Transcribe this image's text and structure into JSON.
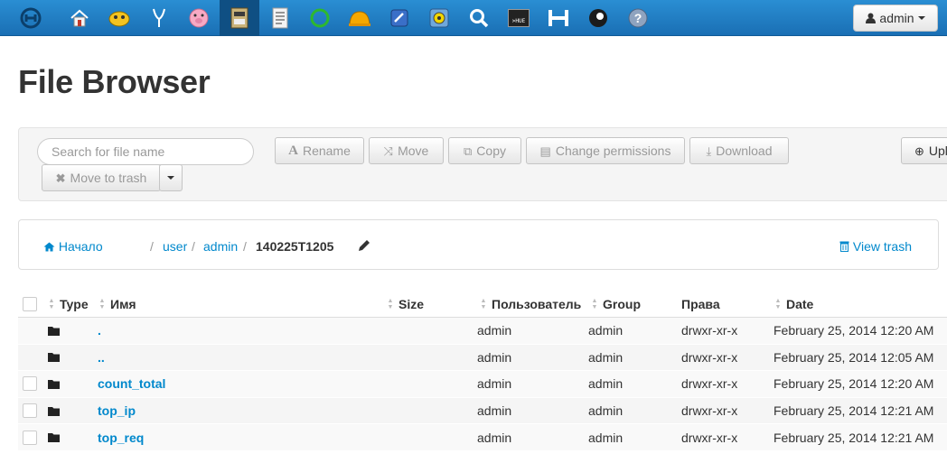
{
  "nav": {
    "apps": [
      {
        "icon": "hue-logo-icon"
      },
      {
        "icon": "home-icon"
      },
      {
        "icon": "hive-icon"
      },
      {
        "icon": "impala-icon"
      },
      {
        "icon": "pig-icon"
      },
      {
        "icon": "file-browser-icon",
        "active": true
      },
      {
        "icon": "job-browser-icon"
      },
      {
        "icon": "oozie-icon"
      },
      {
        "icon": "hbase-icon"
      },
      {
        "icon": "sqoop-icon"
      },
      {
        "icon": "zookeeper-icon"
      },
      {
        "icon": "search-icon"
      },
      {
        "icon": "shell-icon",
        "label": ">HUE"
      },
      {
        "icon": "hdfs-icon"
      },
      {
        "icon": "profile-icon"
      },
      {
        "icon": "help-icon"
      }
    ],
    "user_label": "admin"
  },
  "page": {
    "title": "File Browser"
  },
  "toolbar": {
    "search_placeholder": "Search for file name",
    "rename": "Rename",
    "move": "Move",
    "copy": "Copy",
    "change_permissions": "Change permissions",
    "download": "Download",
    "upload": "Upload",
    "move_to_trash": "Move to trash"
  },
  "breadcrumb": {
    "home": "Начало",
    "separator": "/",
    "parts": [
      "user",
      "admin"
    ],
    "current": "140225T1205",
    "view_trash": "View trash"
  },
  "table": {
    "headers": {
      "type": "Type",
      "name": "Имя",
      "size": "Size",
      "user": "Пользователь",
      "group": "Group",
      "perms": "Права",
      "date": "Date"
    },
    "rows": [
      {
        "name": ".",
        "size": "",
        "user": "admin",
        "group": "admin",
        "perms": "drwxr-xr-x",
        "date": "February 25, 2014 12:20 AM",
        "selectable": false
      },
      {
        "name": "..",
        "size": "",
        "user": "admin",
        "group": "admin",
        "perms": "drwxr-xr-x",
        "date": "February 25, 2014 12:05 AM",
        "selectable": false
      },
      {
        "name": "count_total",
        "size": "",
        "user": "admin",
        "group": "admin",
        "perms": "drwxr-xr-x",
        "date": "February 25, 2014 12:20 AM",
        "selectable": true
      },
      {
        "name": "top_ip",
        "size": "",
        "user": "admin",
        "group": "admin",
        "perms": "drwxr-xr-x",
        "date": "February 25, 2014 12:21 AM",
        "selectable": true
      },
      {
        "name": "top_req",
        "size": "",
        "user": "admin",
        "group": "admin",
        "perms": "drwxr-xr-x",
        "date": "February 25, 2014 12:21 AM",
        "selectable": true
      }
    ]
  },
  "colors": {
    "navbar": "#1f7dc4",
    "link": "#0088cc",
    "active_app": "#0f4f83"
  }
}
